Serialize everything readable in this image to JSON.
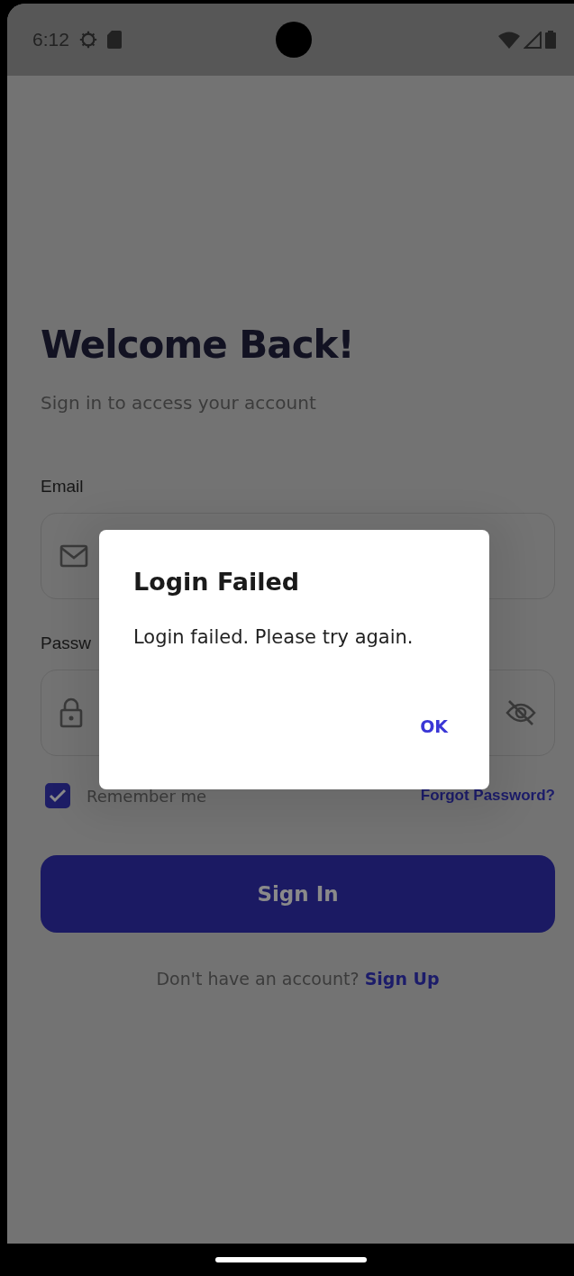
{
  "status_bar": {
    "time": "6:12"
  },
  "title": "Welcome Back!",
  "subtitle": "Sign in to access your account",
  "email": {
    "label": "Email"
  },
  "password": {
    "label": "Passw",
    "visible": false
  },
  "remember": {
    "label": "Remember me",
    "checked": true
  },
  "forgot_link": "Forgot Password?",
  "sign_in_button": "Sign In",
  "signup": {
    "prompt": "Don't have an account?",
    "link": "Sign Up"
  },
  "dialog": {
    "title": "Login Failed",
    "message": "Login failed. Please try again.",
    "buttons": [
      "OK"
    ]
  }
}
